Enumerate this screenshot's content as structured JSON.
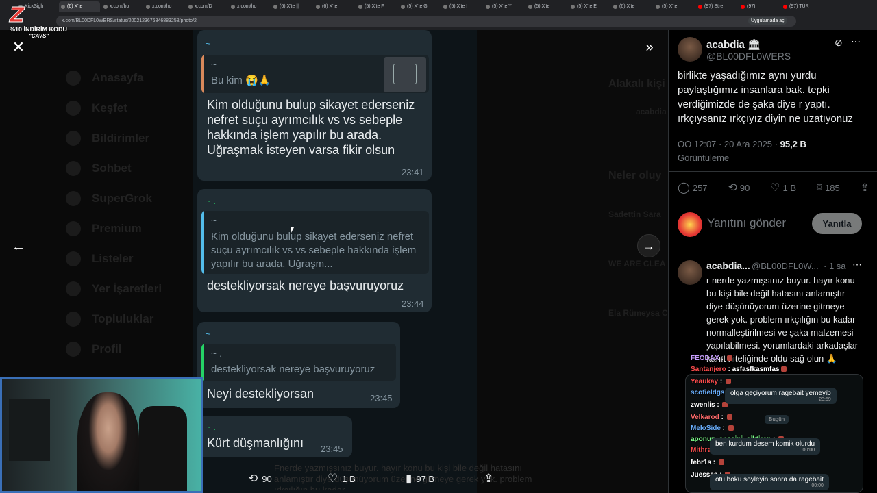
{
  "browser": {
    "tabs": [
      "KickSigh",
      "(6) X'te",
      "x.com/ho",
      "x.com/ho",
      "x.com/D",
      "x.com/ho",
      "(6) X'te ||",
      "(6) X'te",
      "(5) X'te F",
      "(5) X'te G",
      "(5) X'te I",
      "(5) X'te Y",
      "(5) X'te",
      "(5) X'te E",
      "(6) X'te",
      "(5) X'te",
      "(97) Stre",
      "(97)",
      "(97) TÜR"
    ],
    "url": "x.com/BL00DFL0WERS/status/2002123676846883258/photo/2",
    "app_chip": "Uygulamada aç"
  },
  "overlay": {
    "logo_text": "Z",
    "promo": "%10 İNDİRİM KODU",
    "code": "\"CAVS\""
  },
  "background_nav": [
    "Anasayfa",
    "Keşfet",
    "Bildirimler",
    "Sohbet",
    "SuperGrok",
    "Premium",
    "Listeler",
    "Yer İşaretleri",
    "Topluluklar",
    "Profil"
  ],
  "background_right": {
    "related": "Alakalı kişi",
    "handle": "acabdia",
    "whats_happening": "Neler oluy",
    "trend1": "Sadettin Sara",
    "trend2": "WE ARE CLEA",
    "trend3": "Ela Rümeysa C"
  },
  "photo": {
    "messages": [
      {
        "sender": "~",
        "quote_name": "~",
        "quote_text": "Bu kim 😭🙏",
        "text": "Kim olduğunu bulup sikayet ederseniz nefret suçu ayrımcılık vs vs sebeple hakkında işlem yapılır bu arada. Uğraşmak isteyen varsa fikir olsun",
        "time": "23:41"
      },
      {
        "sender": "~ .",
        "quote_name": "~",
        "quote_text": "Kim olduğunu bulup sikayet ederseniz nefret suçu ayrımcılık vs vs sebeple hakkında işlem yapılır bu arada. Uğraşm...",
        "text": "destekliyorsak nereye başvuruyoruz",
        "time": "23:44"
      },
      {
        "sender": "~",
        "quote_name": "~ .",
        "quote_text": "destekliyorsak nereye başvuruyoruz",
        "text": "Neyi destekliyorsan",
        "time": "23:45"
      },
      {
        "sender": "~ .",
        "text": "Kürt düşmanlığını",
        "time": "23:45"
      }
    ],
    "caption_behind": "Fnerde yazmışsınız buyur. hayır konu bu kişi bile değil hatasını anlamıştır diye düşünüyorum üzerine gitmeye gerek yok. problem ırkçılığın bu kadar",
    "actions": {
      "retweets": "90",
      "likes": "1 B",
      "views": "97 B"
    }
  },
  "panel": {
    "name": "acabdia 🏛",
    "handle": "@BL00DFL0WERS",
    "text": "birlikte yaşadığımız aynı yurdu paylaştığımız insanlara bak. tepki verdiğimizde de şaka diye r yaptı. ırkçıysanız ırkçıyız diyin ne uzatıyonuz",
    "time": "ÖÖ 12:07 · 20 Ara 2025 ·",
    "views": "95,2 B",
    "views_label": "Görüntüleme",
    "stats": {
      "replies": "257",
      "reposts": "90",
      "likes": "1 B",
      "bookmarks": "185"
    },
    "reply_placeholder": "Yanıtını gönder",
    "reply_button": "Yanıtla",
    "reply": {
      "name": "acabdia...",
      "handle": "@BL00DFL0W...",
      "age": "· 1 sa",
      "text": "r nerde yazmışsınız buyur. hayır konu bu kişi bile değil hatasını anlamıştır diye düşünüyorum üzerine gitmeye gerek yok. problem ırkçılığın bu kadar normalleştirilmesi ve şaka malzemesi yapılabilmesi. yorumlardaki arkadaşlar kanıt niteliğinde oldu sağ olun 🙏"
    }
  },
  "chat": {
    "lines": [
      {
        "user": "FEODAX",
        "msg": "",
        "color": "#c9a0ff"
      },
      {
        "user": "Santanjero",
        "msg": "asfasfkasmfas",
        "color": "#ff4d4d"
      },
      {
        "user": "Yeaukay",
        "msg": "",
        "color": "#ff4d4d"
      },
      {
        "user": "scofieldgs",
        "msg": "",
        "color": "#6ab0ff"
      },
      {
        "user": "zwenlis",
        "msg": "",
        "color": "#ffffff"
      },
      {
        "user": "Velkarod",
        "msg": "",
        "color": "#ff6b6b"
      },
      {
        "user": "MeloSide",
        "msg": "",
        "color": "#6ab0ff"
      },
      {
        "user": "aponun_anasini_siktiren",
        "msg": "",
        "color": "#7dff8a"
      },
      {
        "user": "MithrandirKick",
        "msg": "",
        "color": "#ff4d4d"
      },
      {
        "user": "febr1s",
        "msg": "",
        "color": "#ffffff"
      },
      {
        "user": "Juessaa",
        "msg": "",
        "color": "#ffffff"
      }
    ],
    "pills": [
      {
        "text": "olga geçiyorum ragebait yemeyib",
        "time": "23:59"
      },
      {
        "text": "ben kurdum desem komik olurdu",
        "time": "00:00"
      },
      {
        "text": "otu boku söyleyin sonra da ragebait",
        "time": "00:00"
      }
    ],
    "day": "Bugün"
  }
}
